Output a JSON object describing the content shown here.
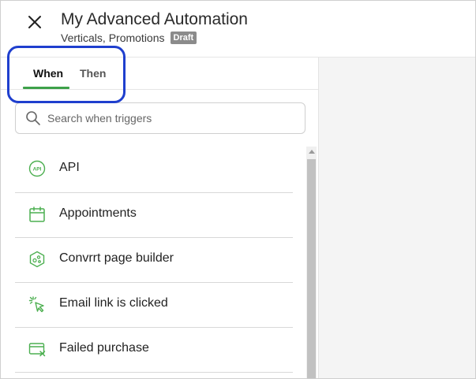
{
  "header": {
    "title": "My Advanced Automation",
    "subtitle": "Verticals, Promotions",
    "badge": "Draft"
  },
  "tabs": [
    {
      "label": "When",
      "active": true
    },
    {
      "label": "Then",
      "active": false
    }
  ],
  "search": {
    "placeholder": "Search when triggers",
    "value": ""
  },
  "triggers": [
    {
      "label": "API",
      "icon": "api-icon"
    },
    {
      "label": "Appointments",
      "icon": "calendar-icon"
    },
    {
      "label": "Convrrt page builder",
      "icon": "page-builder-icon"
    },
    {
      "label": "Email link is clicked",
      "icon": "cursor-click-icon"
    },
    {
      "label": "Failed purchase",
      "icon": "failed-payment-icon"
    }
  ],
  "colors": {
    "accent": "#3da14a",
    "icon": "#4caf50",
    "highlight": "#1f3fce",
    "badge": "#8b8b8b"
  }
}
